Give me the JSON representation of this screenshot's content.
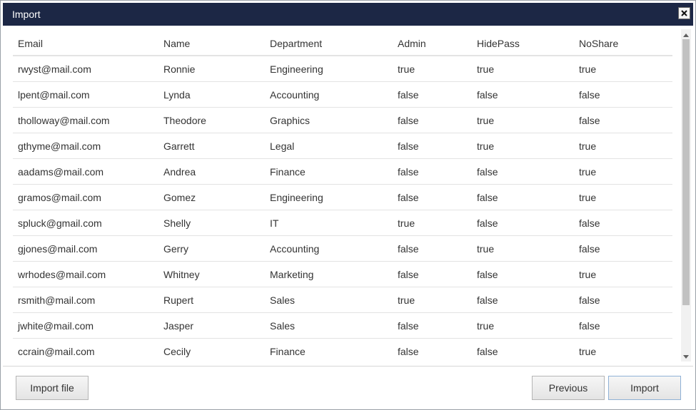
{
  "dialog": {
    "title": "Import"
  },
  "table": {
    "headers": [
      "Email",
      "Name",
      "Department",
      "Admin",
      "HidePass",
      "NoShare"
    ],
    "rows": [
      [
        "rwyst@mail.com",
        "Ronnie",
        "Engineering",
        "true",
        "true",
        "true"
      ],
      [
        "lpent@mail.com",
        "Lynda",
        "Accounting",
        "false",
        "false",
        "false"
      ],
      [
        "tholloway@mail.com",
        "Theodore",
        "Graphics",
        "false",
        "true",
        "false"
      ],
      [
        "gthyme@mail.com",
        "Garrett",
        "Legal",
        "false",
        "true",
        "true"
      ],
      [
        "aadams@mail.com",
        "Andrea",
        "Finance",
        "false",
        "false",
        "true"
      ],
      [
        "gramos@mail.com",
        "Gomez",
        "Engineering",
        "false",
        "false",
        "true"
      ],
      [
        "spluck@gmail.com",
        "Shelly",
        "IT",
        "true",
        "false",
        "false"
      ],
      [
        "gjones@mail.com",
        "Gerry",
        "Accounting",
        "false",
        "true",
        "false"
      ],
      [
        "wrhodes@mail.com",
        "Whitney",
        "Marketing",
        "false",
        "false",
        "true"
      ],
      [
        "rsmith@mail.com",
        "Rupert",
        "Sales",
        "true",
        "false",
        "false"
      ],
      [
        "jwhite@mail.com",
        "Jasper",
        "Sales",
        "false",
        "true",
        "false"
      ],
      [
        "ccrain@mail.com",
        "Cecily",
        "Finance",
        "false",
        "false",
        "true"
      ]
    ]
  },
  "footer": {
    "import_file_label": "Import file",
    "previous_label": "Previous",
    "import_label": "Import"
  },
  "icons": {
    "close": "close-icon",
    "scroll_up": "triangle-up-icon",
    "scroll_down": "triangle-down-icon"
  },
  "colors": {
    "titlebar": "#1c2745",
    "primary_button_border": "#8fb1d6"
  }
}
